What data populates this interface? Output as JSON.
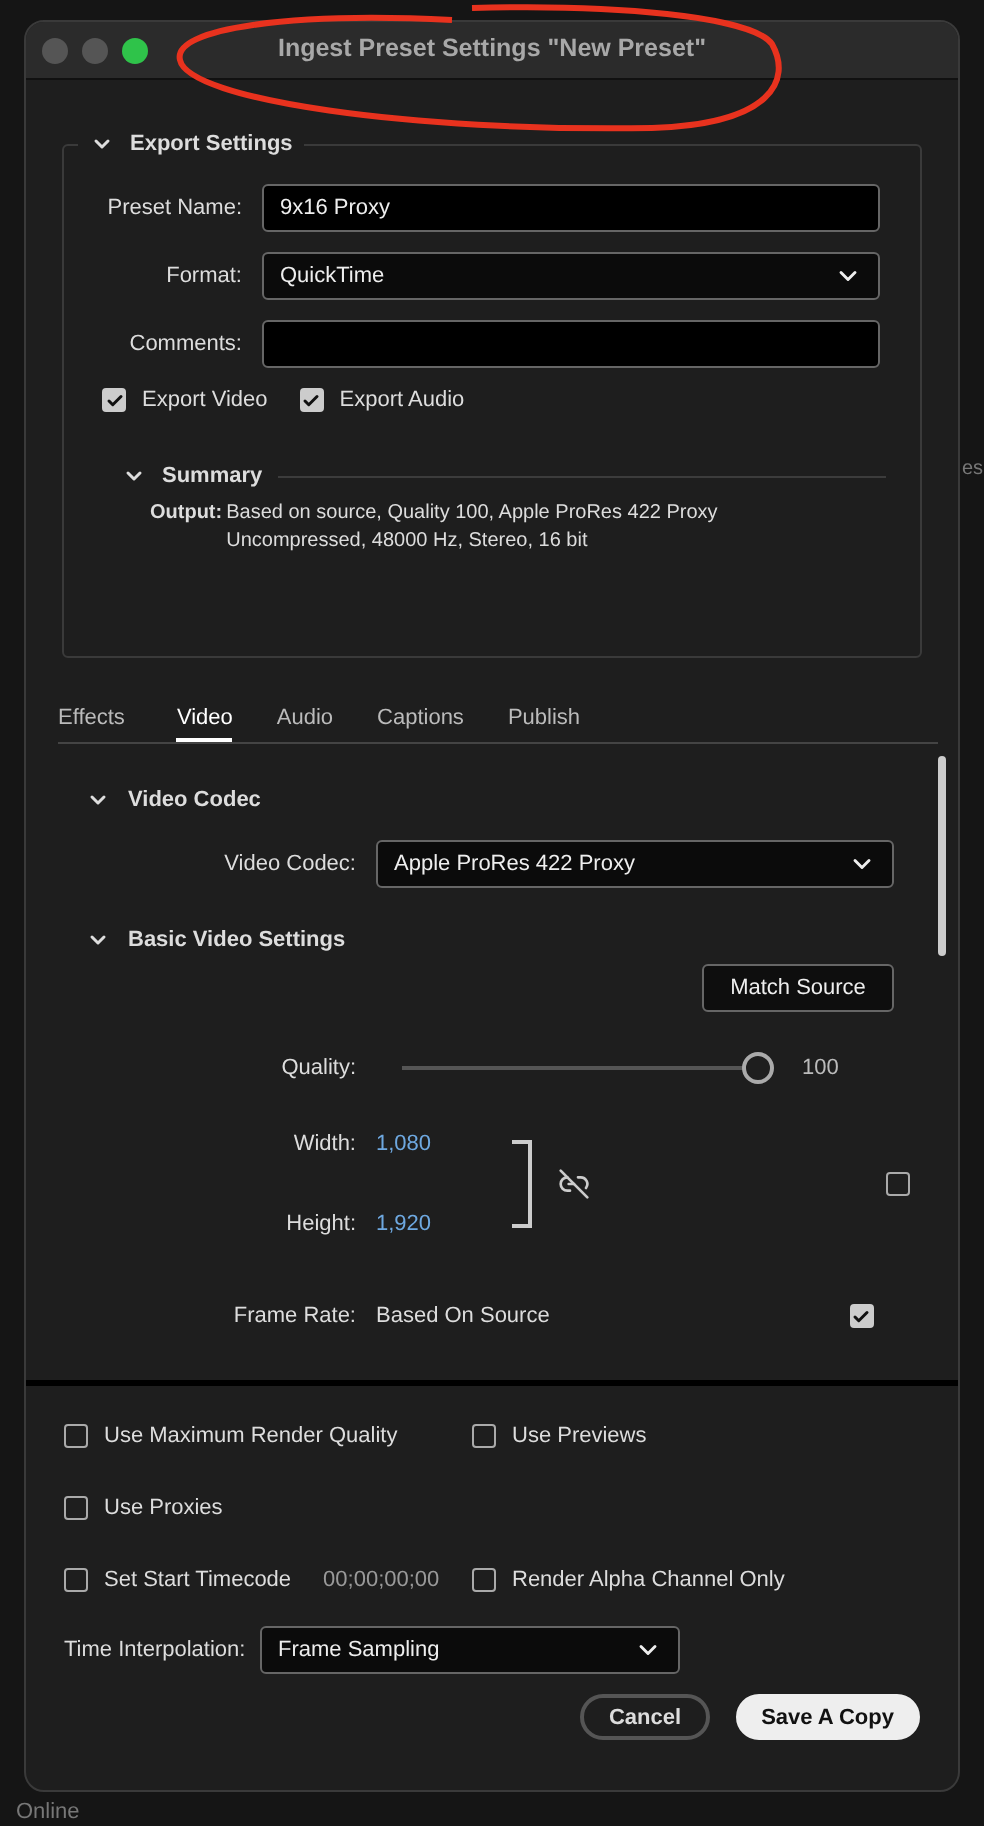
{
  "background_labels": [
    {
      "text": "es",
      "kind": "right"
    },
    {
      "text": "Online",
      "kind": "bottom"
    }
  ],
  "window": {
    "title": "Ingest Preset Settings \"New Preset\""
  },
  "export_settings": {
    "title": "Export Settings",
    "expanded": true,
    "fields": [
      {
        "label": "Preset Name:",
        "kind": "text",
        "value": "9x16 Proxy"
      },
      {
        "label": "Format:",
        "kind": "dropdown",
        "value": "QuickTime"
      },
      {
        "label": "Comments:",
        "kind": "text"
      }
    ],
    "checks": [
      {
        "label": "Export Video",
        "checked": true
      },
      {
        "label": "Export Audio",
        "checked": true
      }
    ],
    "summary": {
      "title": "Summary",
      "expanded": true,
      "output_label": "Output:",
      "output_lines": [
        "Based on source, Quality 100, Apple ProRes 422 Proxy",
        "Uncompressed, 48000 Hz, Stereo, 16 bit"
      ]
    }
  },
  "tabs": [
    {
      "label": "Effects",
      "selected": false
    },
    {
      "label": "Video",
      "selected": true
    },
    {
      "label": "Audio",
      "selected": false
    },
    {
      "label": "Captions",
      "selected": false
    },
    {
      "label": "Publish",
      "selected": false
    }
  ],
  "video_codec": {
    "title": "Video Codec",
    "expanded": true,
    "label": "Video Codec:",
    "value": "Apple ProRes 422 Proxy"
  },
  "basic_video": {
    "title": "Basic Video Settings",
    "expanded": true,
    "match_button": "Match Source",
    "quality": {
      "label": "Quality:",
      "level": 1.0,
      "reading": "100"
    },
    "width": {
      "label": "Width:",
      "value": "1,080"
    },
    "height": {
      "label": "Height:",
      "value": "1,920"
    },
    "linked": false,
    "override_checked": false,
    "frame_rate": {
      "label": "Frame Rate:",
      "value": "Based On Source",
      "checked": true
    }
  },
  "option_rows": [
    [
      {
        "label": "Use Maximum Render Quality",
        "checked": false
      },
      {
        "label": "Use Previews",
        "checked": false
      }
    ],
    [
      {
        "label": "Use Proxies",
        "checked": false
      }
    ],
    [
      {
        "label": "Set Start Timecode",
        "checked": false,
        "extra": "00;00;00;00"
      },
      {
        "label": "Render Alpha Channel Only",
        "checked": false
      }
    ]
  ],
  "time_interpolation": {
    "label": "Time Interpolation:",
    "value": "Frame Sampling"
  },
  "buttons": [
    {
      "label": "Cancel",
      "kind": "secondary"
    },
    {
      "label": "Save A Copy",
      "kind": "primary"
    }
  ]
}
